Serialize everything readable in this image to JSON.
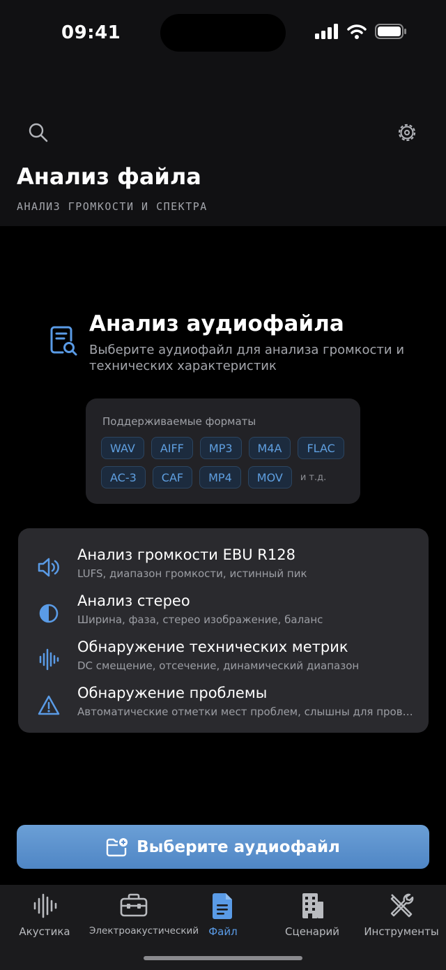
{
  "status": {
    "time": "09:41"
  },
  "header": {
    "title": "Анализ файла",
    "subtitle": "АНАЛИЗ ГРОМКОСТИ И СПЕКТРА",
    "search_icon": "search-icon",
    "settings_icon": "gear-icon"
  },
  "hero": {
    "icon": "document-search-icon",
    "title": "Анализ аудиофайла",
    "description": "Выберите аудиофайл для анализа громкости и технических характеристик"
  },
  "formats": {
    "title": "Поддерживаемые форматы",
    "row1": [
      "WAV",
      "AIFF",
      "MP3",
      "M4A",
      "FLAC"
    ],
    "row2": [
      "AC-3",
      "CAF",
      "MP4",
      "MOV"
    ],
    "etc": "и т.д."
  },
  "features": [
    {
      "icon": "speaker-icon",
      "title": "Анализ громкости EBU R128",
      "desc": "LUFS, диапазон громкости, истинный пик"
    },
    {
      "icon": "half-circle-icon",
      "title": "Анализ стерео",
      "desc": "Ширина, фаза, стерео изображение, баланс"
    },
    {
      "icon": "waveform-icon",
      "title": "Обнаружение технических метрик",
      "desc": "DC смещение, отсечение, динамический диапазон"
    },
    {
      "icon": "warning-icon",
      "title": "Обнаружение проблемы",
      "desc": "Автоматические отметки мест проблем, слышны для прове..."
    }
  ],
  "cta": {
    "icon": "folder-add-icon",
    "label": "Выберите аудиофайл"
  },
  "tabs": [
    {
      "label": "Акустика",
      "icon": "waveform-icon",
      "active": false
    },
    {
      "label": "Электроакустический",
      "icon": "toolbox-icon",
      "active": false
    },
    {
      "label": "Файл",
      "icon": "document-icon",
      "active": true
    },
    {
      "label": "Сценарий",
      "icon": "building-icon",
      "active": false
    },
    {
      "label": "Инструменты",
      "icon": "tools-icon",
      "active": false
    }
  ],
  "colors": {
    "accent": "#5a9be6",
    "button": "#5b8fcf",
    "card": "#2a2a2e"
  }
}
